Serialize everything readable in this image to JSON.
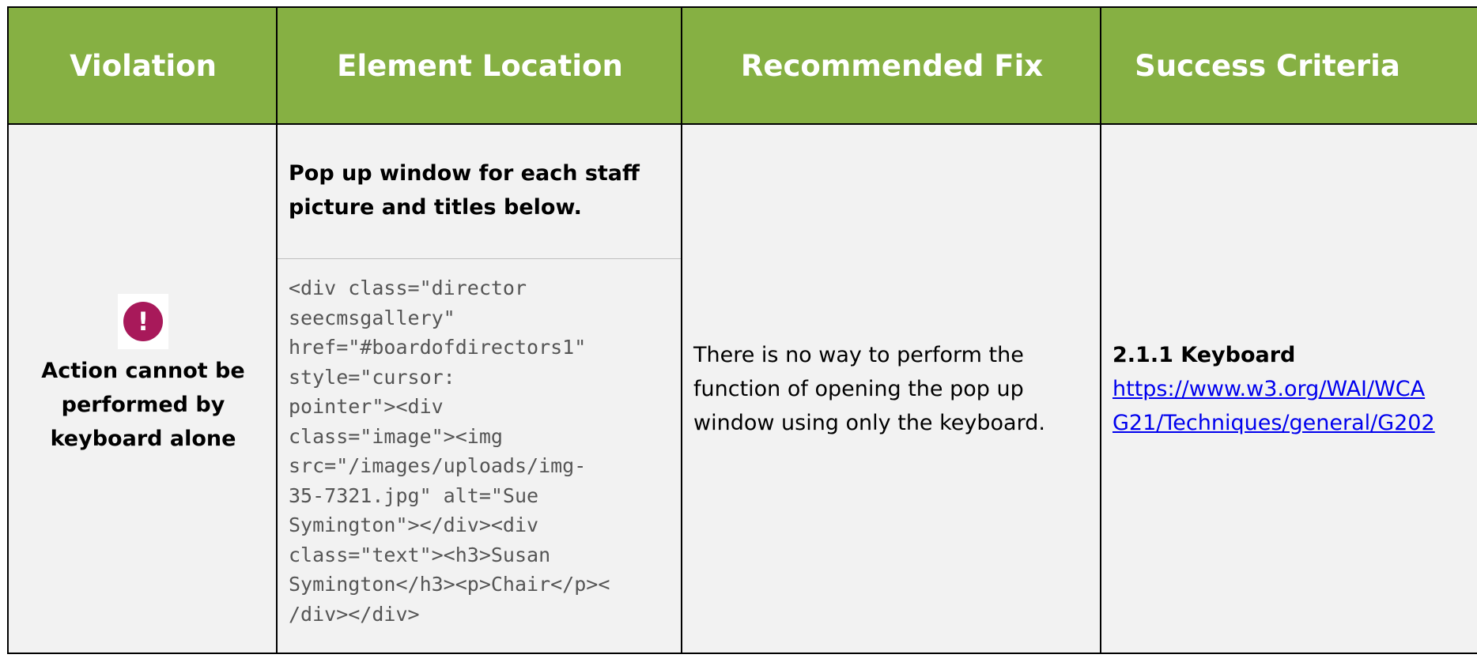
{
  "headers": {
    "violation": "Violation",
    "location": "Element Location",
    "fix": "Recommended Fix",
    "criteria": "Success Criteria"
  },
  "row": {
    "violation": {
      "icon": "alert-circle-icon",
      "icon_glyph": "!",
      "icon_color": "#a8195a",
      "text": "Action cannot be performed by keyboard alone"
    },
    "location": {
      "title": "Pop up window for each staff picture and titles below.",
      "code": "<div class=\"director\nseecmsgallery\"\nhref=\"#boardofdirectors1\"\nstyle=\"cursor:\npointer\"><div\nclass=\"image\"><img\nsrc=\"/images/uploads/img-\n35-7321.jpg\" alt=\"Sue\nSymington\"></div><div\nclass=\"text\"><h3>Susan\nSymington</h3><p>Chair</p><\n/div></div>"
    },
    "fix": {
      "text": "There is no way to perform the function of opening the pop up window using only the keyboard."
    },
    "criteria": {
      "title": "2.1.1 Keyboard",
      "link": "https://www.w3.org/WAI/WCA\nG21/Techniques/general/G202"
    }
  },
  "colors": {
    "header_bg": "#86b043",
    "body_bg": "#f2f2f2",
    "link": "#0000ee"
  }
}
